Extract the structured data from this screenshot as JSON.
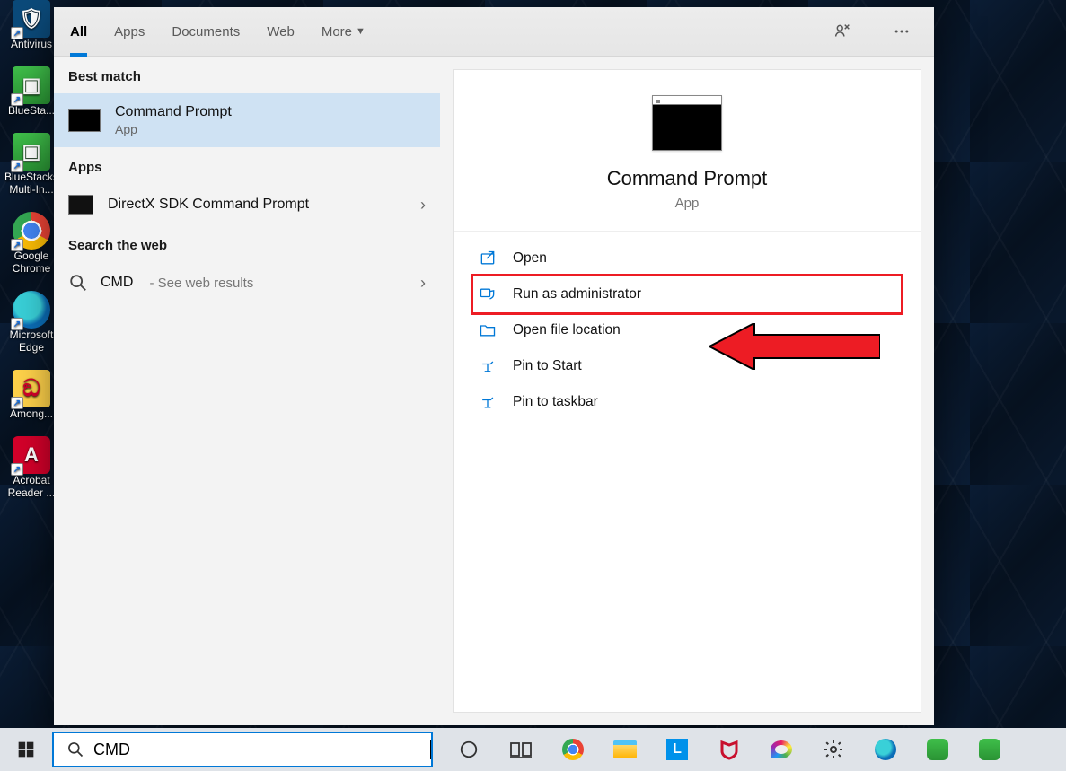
{
  "desktop": {
    "icons": [
      {
        "label": "Antivirus",
        "bg": "#2b6cb0",
        "glyph": "🛡"
      },
      {
        "label": "BlueSta...",
        "bg": "#34c759",
        "glyph": "▣"
      },
      {
        "label": "BlueStacks Multi-In...",
        "bg": "#34c759",
        "glyph": "▣"
      },
      {
        "label": "Google Chrome",
        "bg": "#fff",
        "glyph": ""
      },
      {
        "label": "Microsoft Edge",
        "bg": "#0b6db7",
        "glyph": ""
      },
      {
        "label": "Among...",
        "bg": "#e53e3e",
        "glyph": ""
      },
      {
        "label": "Acrobat Reader ...",
        "bg": "#d4002a",
        "glyph": ""
      }
    ]
  },
  "tabs": {
    "items": [
      "All",
      "Apps",
      "Documents",
      "Web",
      "More"
    ],
    "active_index": 0
  },
  "left": {
    "best_match_hdr": "Best match",
    "best_match": {
      "title": "Command Prompt",
      "sub": "App"
    },
    "apps_hdr": "Apps",
    "apps": [
      {
        "title": "DirectX SDK Command Prompt"
      }
    ],
    "web_hdr": "Search the web",
    "web": {
      "title": "CMD",
      "sub": "- See web results"
    }
  },
  "preview": {
    "title": "Command Prompt",
    "sub": "App",
    "actions": [
      {
        "label": "Open"
      },
      {
        "label": "Run as administrator"
      },
      {
        "label": "Open file location"
      },
      {
        "label": "Pin to Start"
      },
      {
        "label": "Pin to taskbar"
      }
    ],
    "highlight_index": 1
  },
  "search": {
    "value": "CMD"
  }
}
